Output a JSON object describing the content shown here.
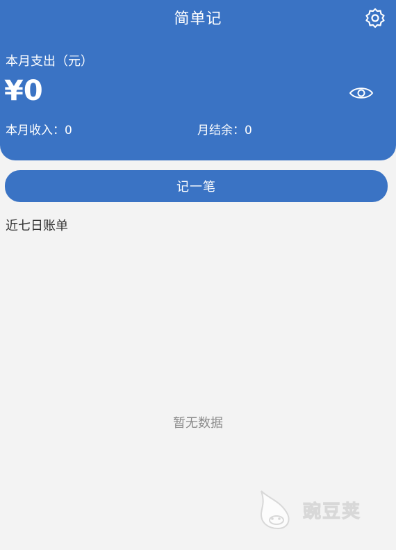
{
  "header": {
    "title": "简单记",
    "expense_label": "本月支出（元）",
    "expense_amount": "¥0",
    "income_label": "本月收入：",
    "income_value": "0",
    "balance_label": "月结余：",
    "balance_value": "0",
    "icons": {
      "settings": "settings-gear-icon",
      "visibility": "eye-icon"
    }
  },
  "actions": {
    "record_label": "记一笔"
  },
  "recent": {
    "title": "近七日账单",
    "empty_text": "暂无数据"
  },
  "watermark": {
    "text": "豌豆荚"
  },
  "colors": {
    "primary": "#3a73c4",
    "background": "#f3f3f3",
    "muted_text": "#8a8a8a"
  }
}
